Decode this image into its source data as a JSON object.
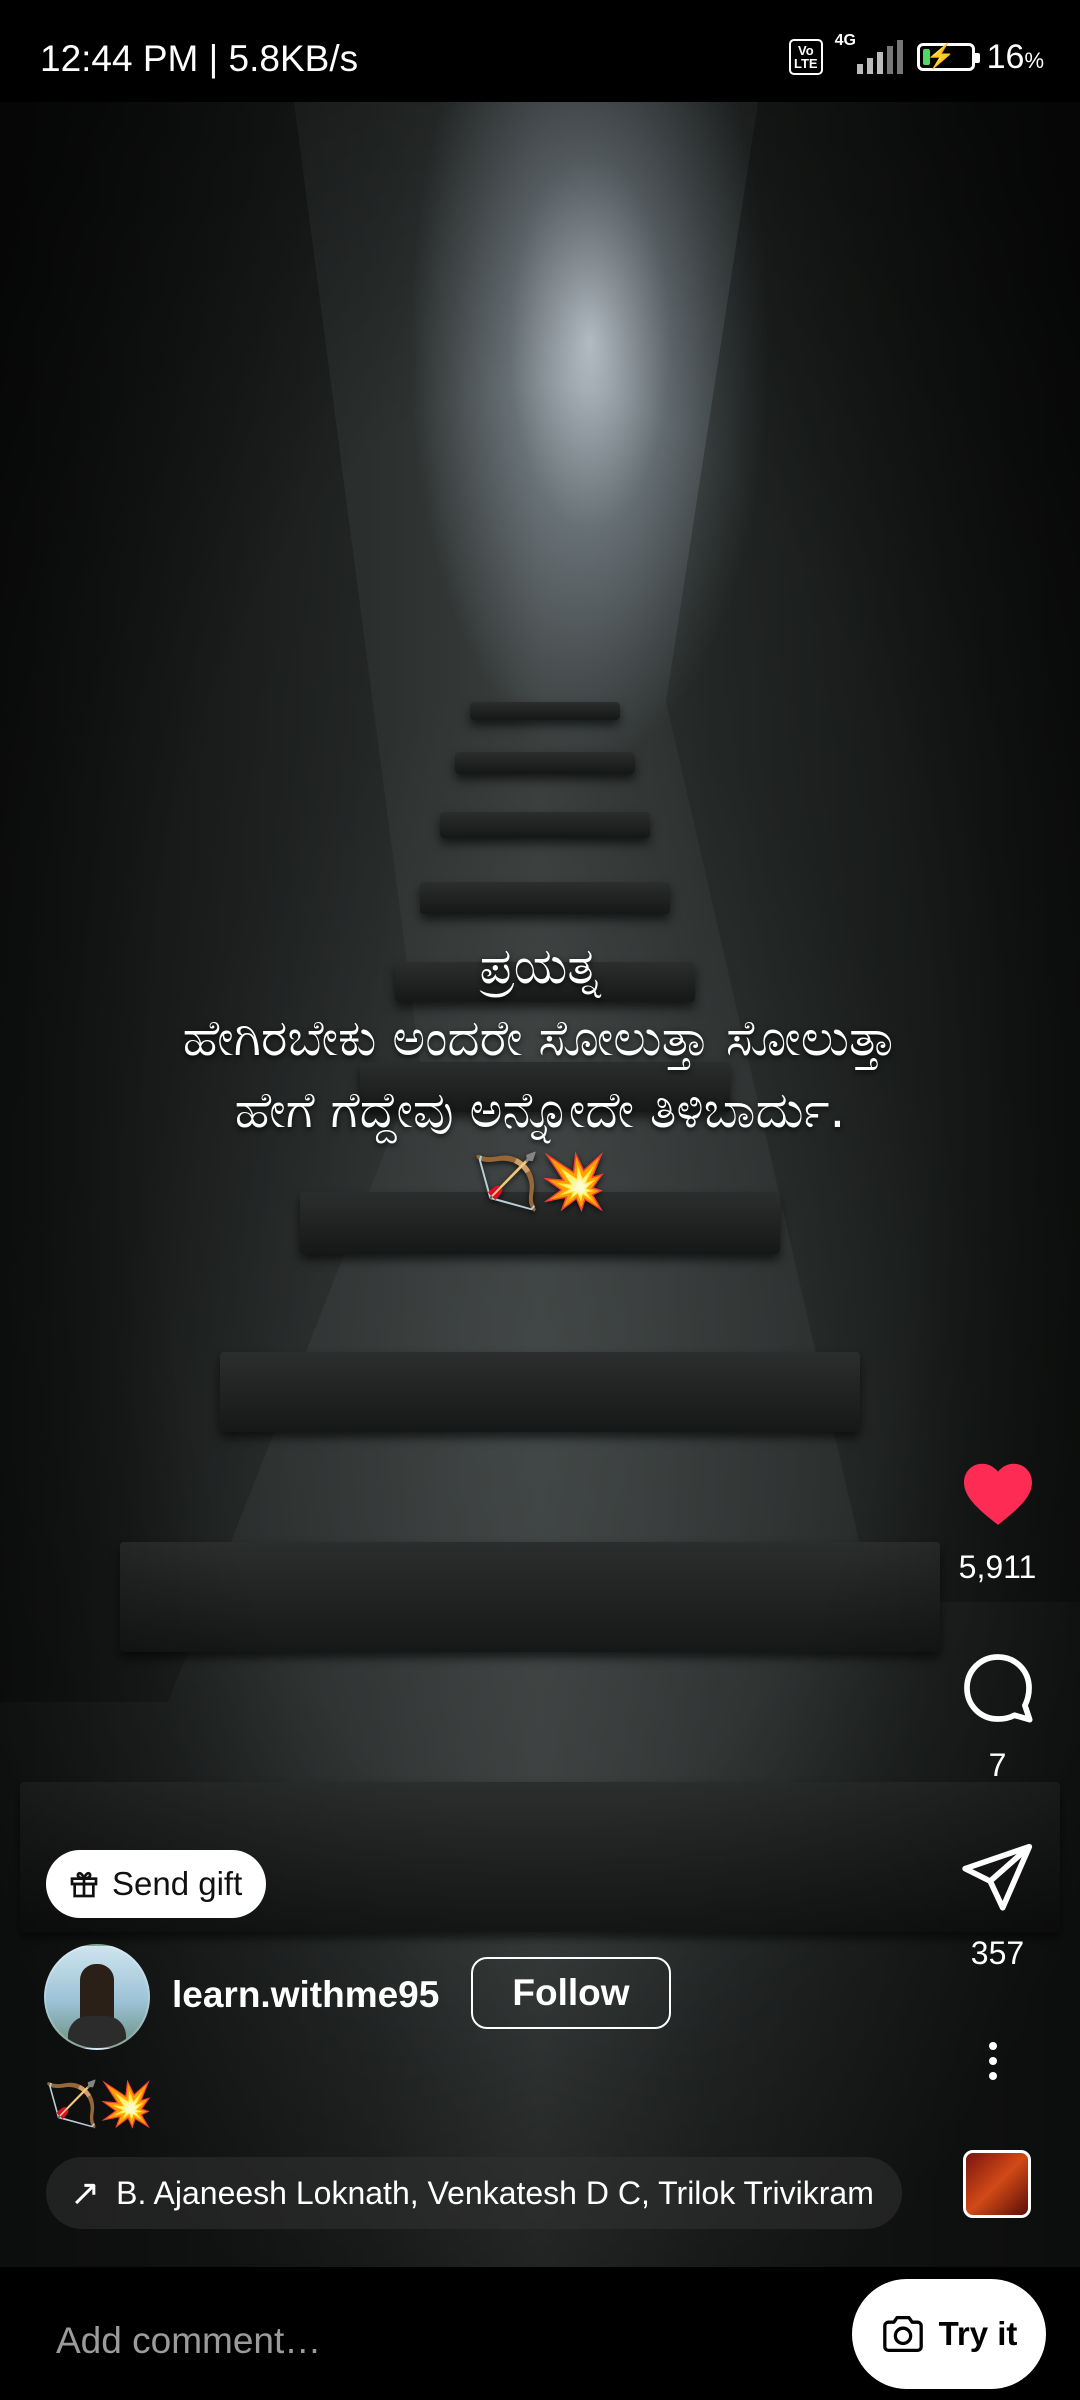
{
  "status_bar": {
    "time": "12:44 PM | 5.8KB/s",
    "volte": "Vo LTE",
    "network": "4G",
    "battery_level": 0.16,
    "battery_percent": "16",
    "battery_unit": "%"
  },
  "reel": {
    "caption_lines": [
      "ಪ್ರಯತ್ನ",
      "ಹೇಗಿರಬೇಕು ಅಂದರೇ ಸೋಲುತ್ತಾ ಸೋಲುತ್ತಾ",
      "ಹೇಗೆ ಗೆದ್ದೇವು ಅನ್ನೋದೇ ತಿಳಿಬಾರ್ದು."
    ],
    "caption_emojis": "🏹💥"
  },
  "actions": {
    "likes": "5,911",
    "comments": "7",
    "shares": "357"
  },
  "gift": {
    "label": "Send gift"
  },
  "author": {
    "username": "learn.withme95",
    "follow_label": "Follow"
  },
  "post_caption": "🏹💥",
  "audio": {
    "text": "B. Ajaneesh Loknath, Venkatesh D C, Trilok Trivikram"
  },
  "comment": {
    "placeholder": "Add comment…",
    "try_it_label": "Try it"
  },
  "colors": {
    "like_red": "#fe2c55",
    "battery_green": "#4cd964"
  }
}
